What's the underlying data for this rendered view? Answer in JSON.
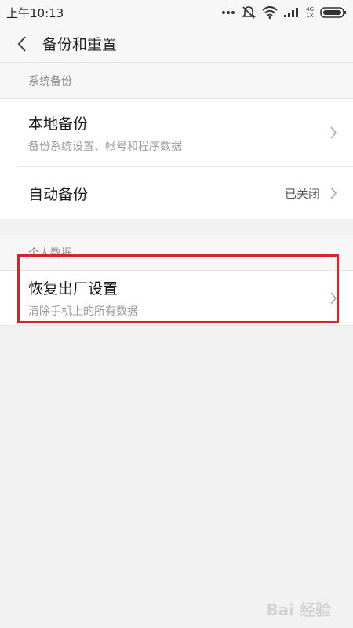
{
  "status_bar": {
    "time": "上午10:13",
    "network_top": "4G",
    "network_bottom": "1X"
  },
  "header": {
    "title": "备份和重置"
  },
  "sections": [
    {
      "header": "系统备份",
      "items": [
        {
          "title": "本地备份",
          "subtitle": "备份系统设置、帐号和程序数据"
        },
        {
          "title": "自动备份",
          "value": "已关闭"
        }
      ]
    },
    {
      "header": "个人数据",
      "items": [
        {
          "title": "恢复出厂设置",
          "subtitle": "清除手机上的所有数据"
        }
      ]
    }
  ],
  "annotation": {
    "highlight_color": "#d9232a"
  },
  "watermark": {
    "text": "Bai 经验"
  }
}
